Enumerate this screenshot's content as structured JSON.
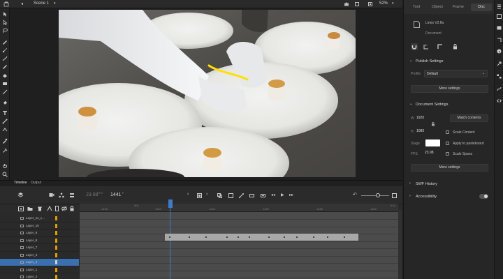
{
  "topbar": {
    "scene_label": "Scene 1",
    "zoom": "52%"
  },
  "timeline": {
    "tabs": [
      "Timeline",
      "Output"
    ],
    "fps": "23.98",
    "fps_unit": "FPS",
    "frame": "1441",
    "frame_unit": "F",
    "ruler_ticks": [
      "1435",
      "1440",
      "1445",
      "1450",
      "1455",
      "1460"
    ],
    "ruler_top_marks": [
      "60s",
      "61s"
    ],
    "layers": [
      "Layer_11_c...",
      "Layer_10",
      "Layer_9",
      "Layer_8",
      "Layer_7",
      "Layer_3",
      "Layer_4",
      "Layer_1",
      "Layer_2"
    ],
    "selected_layer_index": 6
  },
  "panel": {
    "tabs": [
      "Tool",
      "Object",
      "Frame",
      "Doc"
    ],
    "active_tab": "Doc",
    "doc_name": "Lines V2.fla",
    "doc_type": "Document",
    "publish": {
      "title": "Publish Settings",
      "profile_label": "Profile",
      "profile_value": "Default",
      "more_settings": "More settings"
    },
    "doc_settings": {
      "title": "Document Settings",
      "w_label": "W",
      "w_value": "1920",
      "h_label": "H",
      "h_value": "1080",
      "match_contents": "Match contents",
      "scale_content": "Scale Content",
      "stage_label": "Stage",
      "apply_pasteboard": "Apply to pasteboard",
      "fps_label": "FPS",
      "fps_value": "23.98",
      "scale_spans": "Scale Spans",
      "more_settings": "More settings",
      "stage_color": "#ffffff"
    },
    "swf_history": "SWF History",
    "accessibility": "Accessibility"
  }
}
